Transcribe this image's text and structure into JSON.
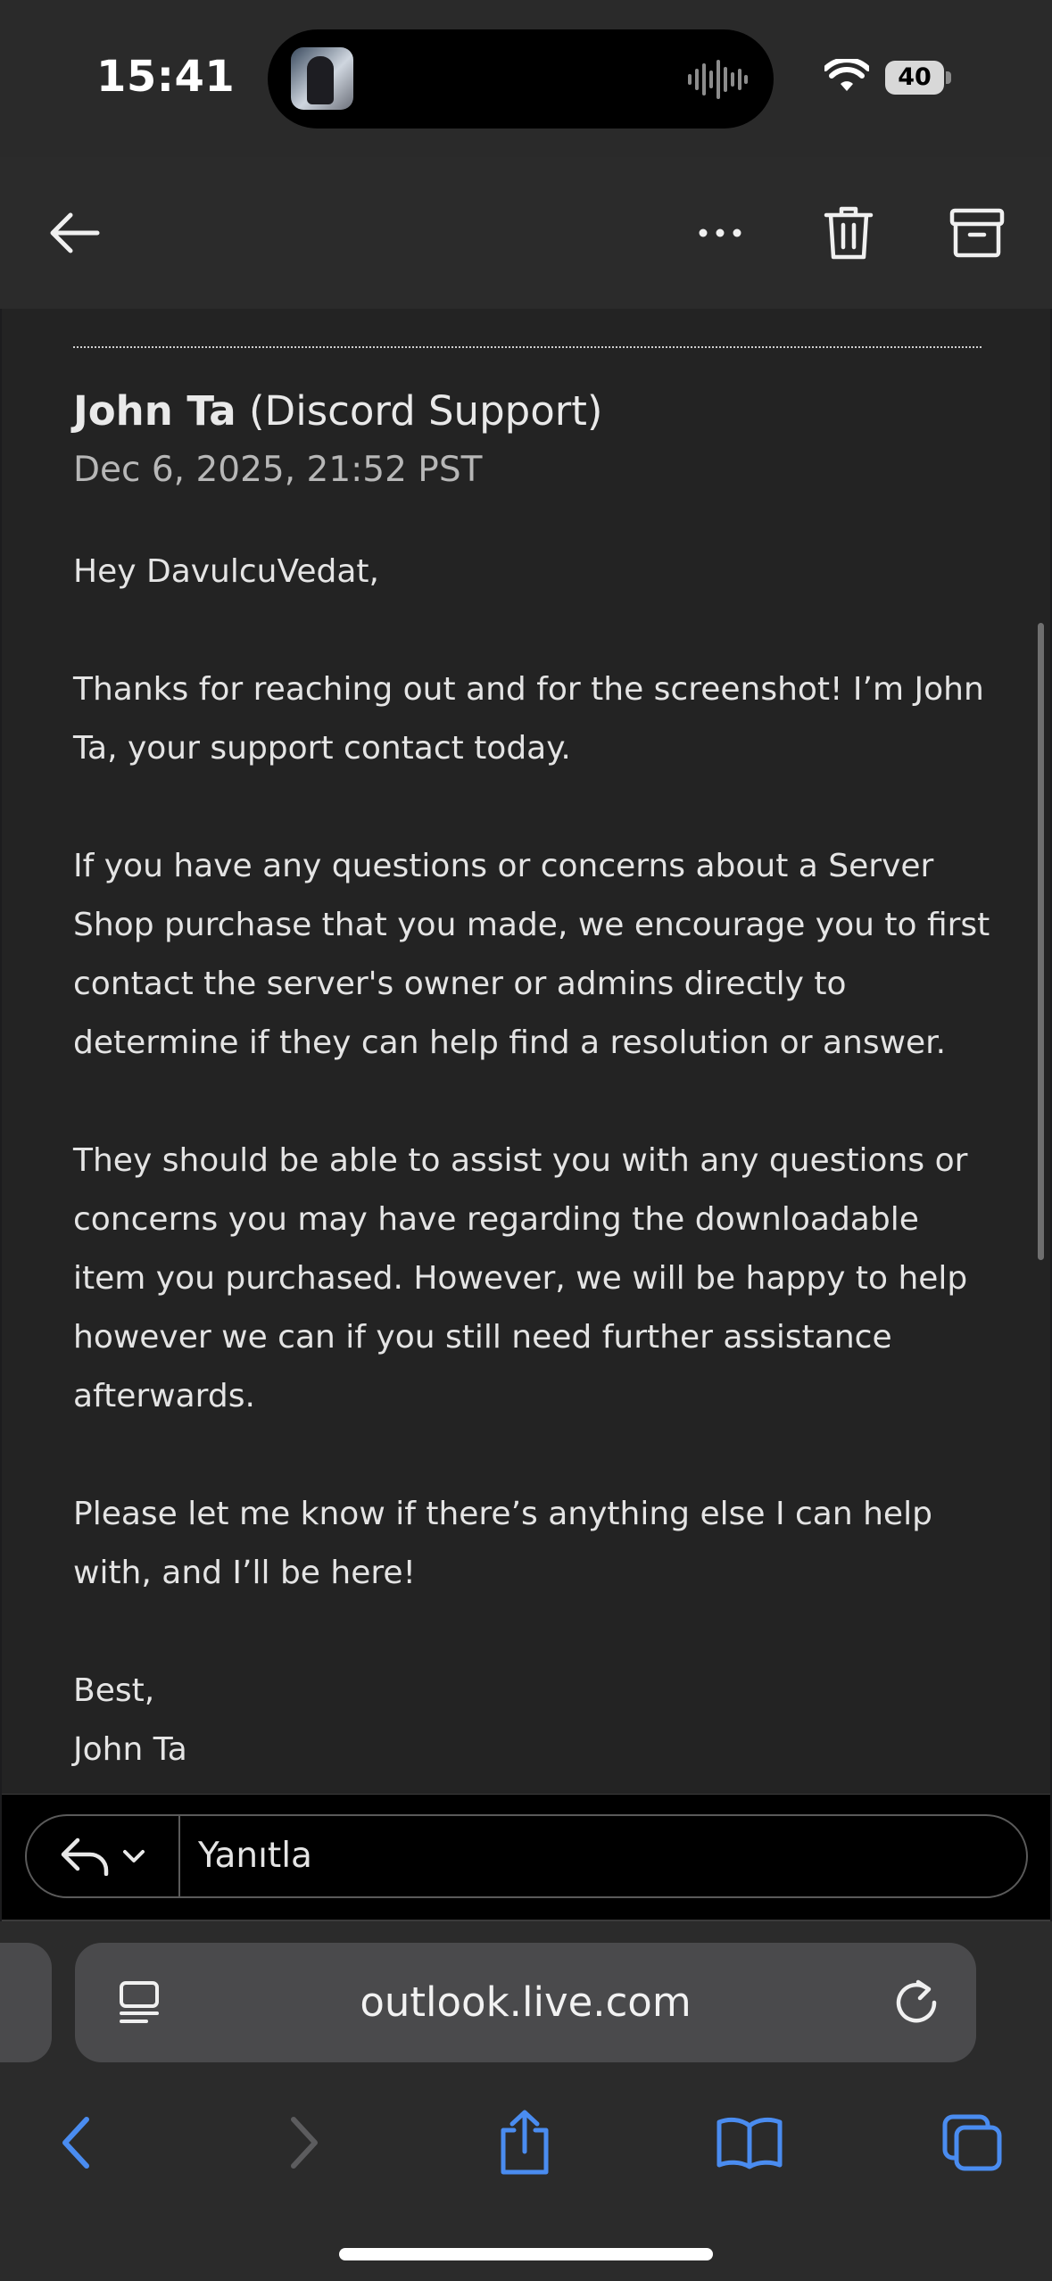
{
  "status_bar": {
    "time": "15:41",
    "battery": "40",
    "icons": [
      "now-playing-artwork",
      "audio-waveform-icon",
      "wifi-icon",
      "battery-icon"
    ]
  },
  "toolbar": {
    "icons": [
      "back-arrow-icon",
      "more-icon",
      "trash-icon",
      "archive-icon"
    ]
  },
  "email": {
    "sender_name": "John Ta",
    "sender_org": "(Discord Support)",
    "date": "Dec 6, 2025, 21:52 PST",
    "paragraphs": [
      "Hey DavulcuVedat,",
      "Thanks for reaching out and for the screenshot! I’m John Ta, your support contact today.",
      "If you have any questions or concerns about a Server Shop purchase that you made, we encourage you to first contact the server's owner or admins directly to determine if they can help find a resolution or answer.",
      "They should be able to assist you with any questions or concerns you may have regarding the downloadable item you purchased. However, we will be happy to help however we can if you still need further assistance afterwards.",
      "Please let me know if there’s anything else I can help with, and I’ll be here!"
    ],
    "signoff": "Best,",
    "signature": "John Ta"
  },
  "reply": {
    "placeholder": "Yanıtla",
    "icons": [
      "reply-icon",
      "chevron-down-icon"
    ]
  },
  "safari": {
    "url": "outlook.live.com",
    "icons": [
      "reader-icon",
      "reload-icon",
      "back-icon",
      "forward-icon",
      "share-icon",
      "bookmarks-icon",
      "tabs-icon"
    ]
  },
  "colors": {
    "accent": "#4a8cf0",
    "background": "#232323",
    "toolbar": "#2b2b2b"
  }
}
